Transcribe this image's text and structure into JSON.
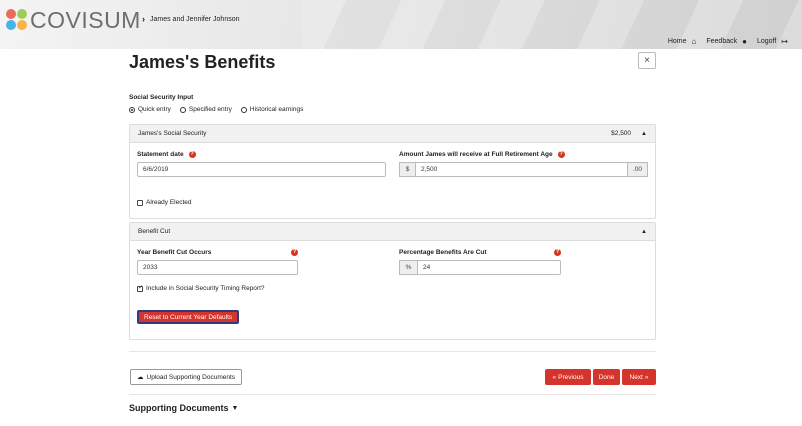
{
  "header": {
    "logo_text": "COVISUM",
    "breadcrumb": "James and Jennifer Johnson",
    "nav": [
      {
        "label": "Home",
        "icon": "home-icon"
      },
      {
        "label": "Feedback",
        "icon": "comment-icon"
      },
      {
        "label": "Logoff",
        "icon": "sign-out-icon"
      }
    ]
  },
  "page": {
    "title": "James's Benefits",
    "close_glyph": "×"
  },
  "ss_input": {
    "label": "Social Security Input",
    "options": [
      {
        "label": "Quick entry",
        "selected": true
      },
      {
        "label": "Specified entry",
        "selected": false
      },
      {
        "label": "Historical earnings",
        "selected": false
      }
    ]
  },
  "ss_panel": {
    "title": "James's Social Security",
    "amount": "$2,500",
    "statement_date_label": "Statement date",
    "statement_date_value": "6/6/2019",
    "fra_label": "Amount James will receive at Full Retirement Age",
    "fra_prefix": "$",
    "fra_value": "2,500",
    "fra_suffix": ".00",
    "already_elected_label": "Already Elected",
    "already_elected_checked": false
  },
  "cut_panel": {
    "title": "Benefit Cut",
    "year_label": "Year Benefit Cut Occurs",
    "year_value": "2033",
    "pct_label": "Percentage Benefits Are Cut",
    "pct_prefix": "%",
    "pct_value": "24",
    "include_label": "Include in Social Security Timing Report?",
    "include_checked": true,
    "reset_label": "Reset to Current Year Defaults"
  },
  "footer": {
    "upload_label": "Upload Supporting Documents",
    "previous_label": "Previous",
    "done_label": "Done",
    "next_label": "Next",
    "docs_title": "Supporting Documents"
  },
  "colors": {
    "accent_red": "#d4342b",
    "help_red": "#d9341e"
  }
}
